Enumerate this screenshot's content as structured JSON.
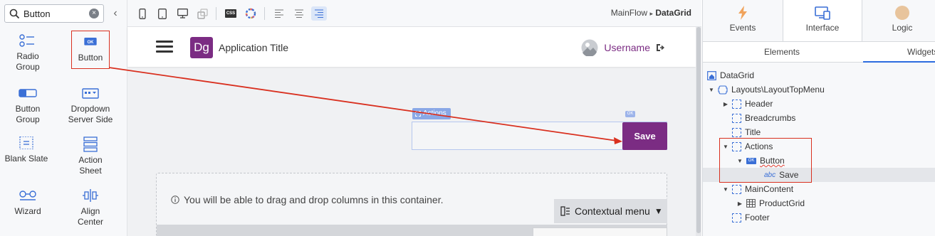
{
  "palette": {
    "search": {
      "value": "Button"
    },
    "clear_glyph": "×",
    "collapse_glyph": "‹",
    "widgets": [
      {
        "label": "Radio\nGroup",
        "icon": "radio-group-icon"
      },
      {
        "label": "Button",
        "icon": "button-ok-icon",
        "selected": true
      },
      {
        "label": "Button\nGroup",
        "icon": "button-group-icon"
      },
      {
        "label": "Dropdown\nServer Side",
        "icon": "dropdown-server-side-icon"
      },
      {
        "label": "Blank Slate",
        "icon": "blank-slate-icon"
      },
      {
        "label": "Action\nSheet",
        "icon": "action-sheet-icon"
      },
      {
        "label": "Wizard",
        "icon": "wizard-icon"
      },
      {
        "label": "Align\nCenter",
        "icon": "align-center-icon"
      }
    ],
    "ok_badge": "OK"
  },
  "toolbar": {
    "css_badge": "CSS",
    "breadcrumb_flow": "MainFlow",
    "breadcrumb_sep": "▸",
    "breadcrumb_screen": "DataGrid"
  },
  "canvas": {
    "logo_text": "Dg",
    "app_title": "Application Title",
    "username": "Username",
    "actions_tag": "Actions",
    "ok_tag": "OK",
    "save_label": "Save",
    "columns_info": "You will be able to drag and drop columns in this container.",
    "contextual_menu": "Contextual menu"
  },
  "right_panel": {
    "tabs": [
      {
        "label": "Events",
        "icon": "lightning-icon"
      },
      {
        "label": "Interface",
        "icon": "interface-icon",
        "active": true
      },
      {
        "label": "Logic",
        "icon": "logic-icon"
      }
    ],
    "subtabs": [
      "Elements",
      "Widgets"
    ],
    "tree": [
      {
        "label": "DataGrid",
        "icon": "screen-icon",
        "depth": 0,
        "arrow": ""
      },
      {
        "label": "Layouts\\LayoutTopMenu",
        "icon": "layout-icon",
        "depth": 0,
        "arrow": "▼"
      },
      {
        "label": "Header",
        "icon": "placeholder-icon",
        "depth": 1,
        "arrow": "▶"
      },
      {
        "label": "Breadcrumbs",
        "icon": "placeholder-icon",
        "depth": 1,
        "arrow": ""
      },
      {
        "label": "Title",
        "icon": "placeholder-icon",
        "depth": 1,
        "arrow": ""
      },
      {
        "label": "Actions",
        "icon": "placeholder-icon",
        "depth": 1,
        "arrow": "▼"
      },
      {
        "label": "Button",
        "icon": "button-ok-icon",
        "depth": 2,
        "arrow": "▼"
      },
      {
        "label": "Save",
        "icon": "text-abc-icon",
        "depth": 3,
        "arrow": "",
        "highlight": true
      },
      {
        "label": "MainContent",
        "icon": "placeholder-icon",
        "depth": 1,
        "arrow": "▼"
      },
      {
        "label": "ProductGrid",
        "icon": "table-icon",
        "depth": 2,
        "arrow": "▶"
      },
      {
        "label": "Footer",
        "icon": "placeholder-icon",
        "depth": 1,
        "arrow": ""
      }
    ],
    "abc_glyph": "abc"
  },
  "colors": {
    "brand_purple": "#7b2c83",
    "annotation_red": "#d9301f",
    "accent_blue": "#3a6fd6"
  }
}
